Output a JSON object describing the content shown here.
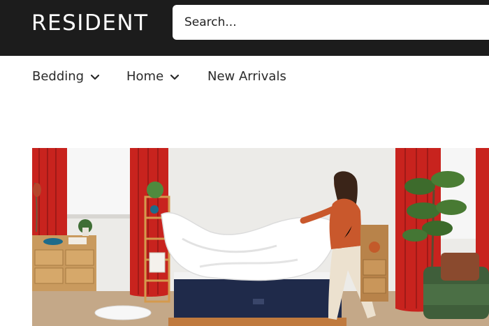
{
  "header": {
    "logo": "RESIDENT",
    "search_placeholder": "Search..."
  },
  "nav": {
    "items": [
      {
        "label": "Bedding",
        "icon": "chevron-down-icon"
      },
      {
        "label": "Home",
        "icon": "chevron-down-icon"
      },
      {
        "label": "New Arrivals"
      }
    ]
  },
  "colors": {
    "header_bg": "#1c1c1c",
    "curtain_red": "#c8231e",
    "mattress_navy": "#1f2a4a"
  }
}
